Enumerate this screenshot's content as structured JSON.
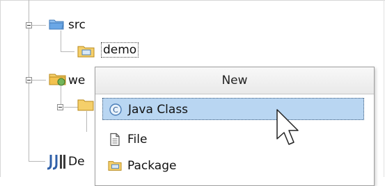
{
  "tree": {
    "rows": [
      {
        "label": "src",
        "icon": "source-folder-icon"
      },
      {
        "label": "demo",
        "icon": "package-folder-icon"
      },
      {
        "label": "we",
        "icon": "web-folder-icon"
      },
      {
        "label": "De",
        "icon": "java-ee-icon"
      }
    ]
  },
  "popup": {
    "title": "New",
    "items": [
      {
        "label": "Java Class",
        "icon": "java-class-icon"
      },
      {
        "label": "File",
        "icon": "file-icon"
      },
      {
        "label": "Package",
        "icon": "package-icon"
      }
    ]
  },
  "colors": {
    "selection": "#b9d6f2",
    "folder": "#f3c24f",
    "src_folder": "#6aa7e6"
  }
}
